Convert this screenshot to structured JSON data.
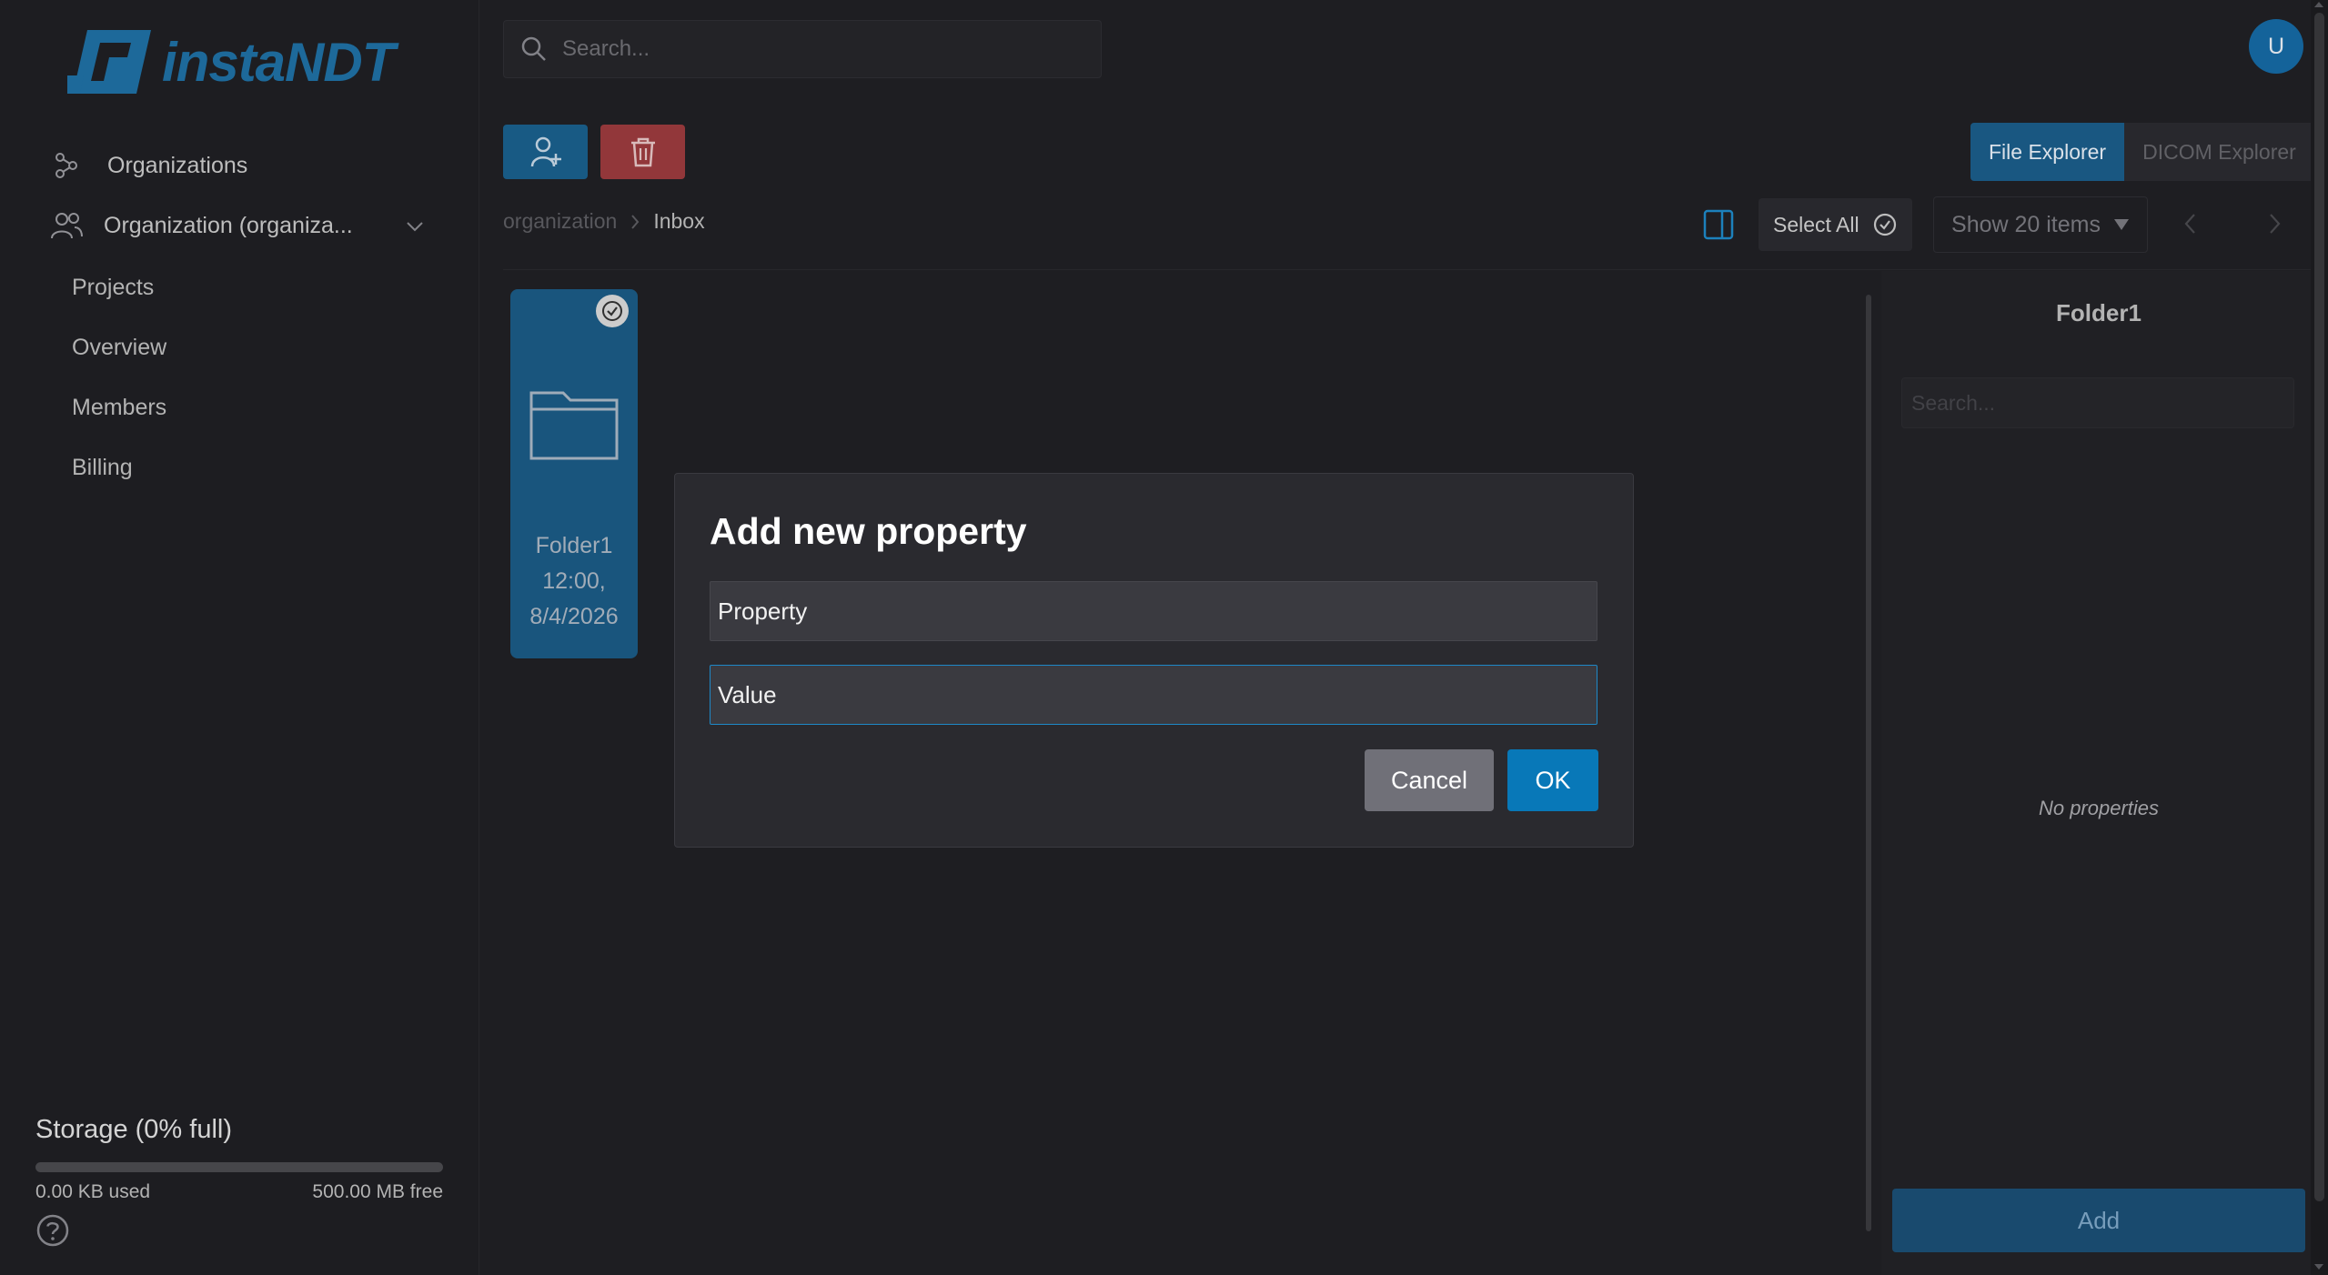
{
  "app": {
    "brand": "instaNDT",
    "brand_color": "#1f6fa3",
    "accent_color": "#0878b8"
  },
  "sidebar": {
    "items": [
      {
        "label": "Organizations",
        "icon": "nodes-icon"
      },
      {
        "label": "Organization (organiza...",
        "icon": "users-icon",
        "expanded": true
      }
    ],
    "sub_items": [
      {
        "label": "Projects"
      },
      {
        "label": "Overview"
      },
      {
        "label": "Members"
      },
      {
        "label": "Billing"
      }
    ],
    "storage": {
      "title": "Storage (0% full)",
      "used": "0.00 KB used",
      "free": "500.00 MB free",
      "fraction_full": 0
    }
  },
  "topbar": {
    "search_placeholder": "Search...",
    "avatar_initial": "U"
  },
  "toolbar": {
    "add_user_icon": "add-user-icon",
    "delete_icon": "trash-icon",
    "view_tabs": [
      {
        "label": "File Explorer",
        "active": true
      },
      {
        "label": "DICOM Explorer",
        "active": false
      }
    ]
  },
  "breadcrumb": {
    "items": [
      "organization",
      "Inbox"
    ]
  },
  "listing": {
    "select_all_label": "Select All",
    "page_size_label": "Show 20 items"
  },
  "folder": {
    "name": "Folder1",
    "time": "12:00,",
    "date": "8/4/2026",
    "selected": true
  },
  "properties_panel": {
    "title": "Folder1",
    "search_placeholder": "Search...",
    "empty_text": "No properties",
    "add_label": "Add"
  },
  "dialog": {
    "title": "Add new property",
    "property_placeholder": "Property",
    "value_placeholder": "Value",
    "value_text": "Value",
    "cancel_label": "Cancel",
    "ok_label": "OK"
  }
}
